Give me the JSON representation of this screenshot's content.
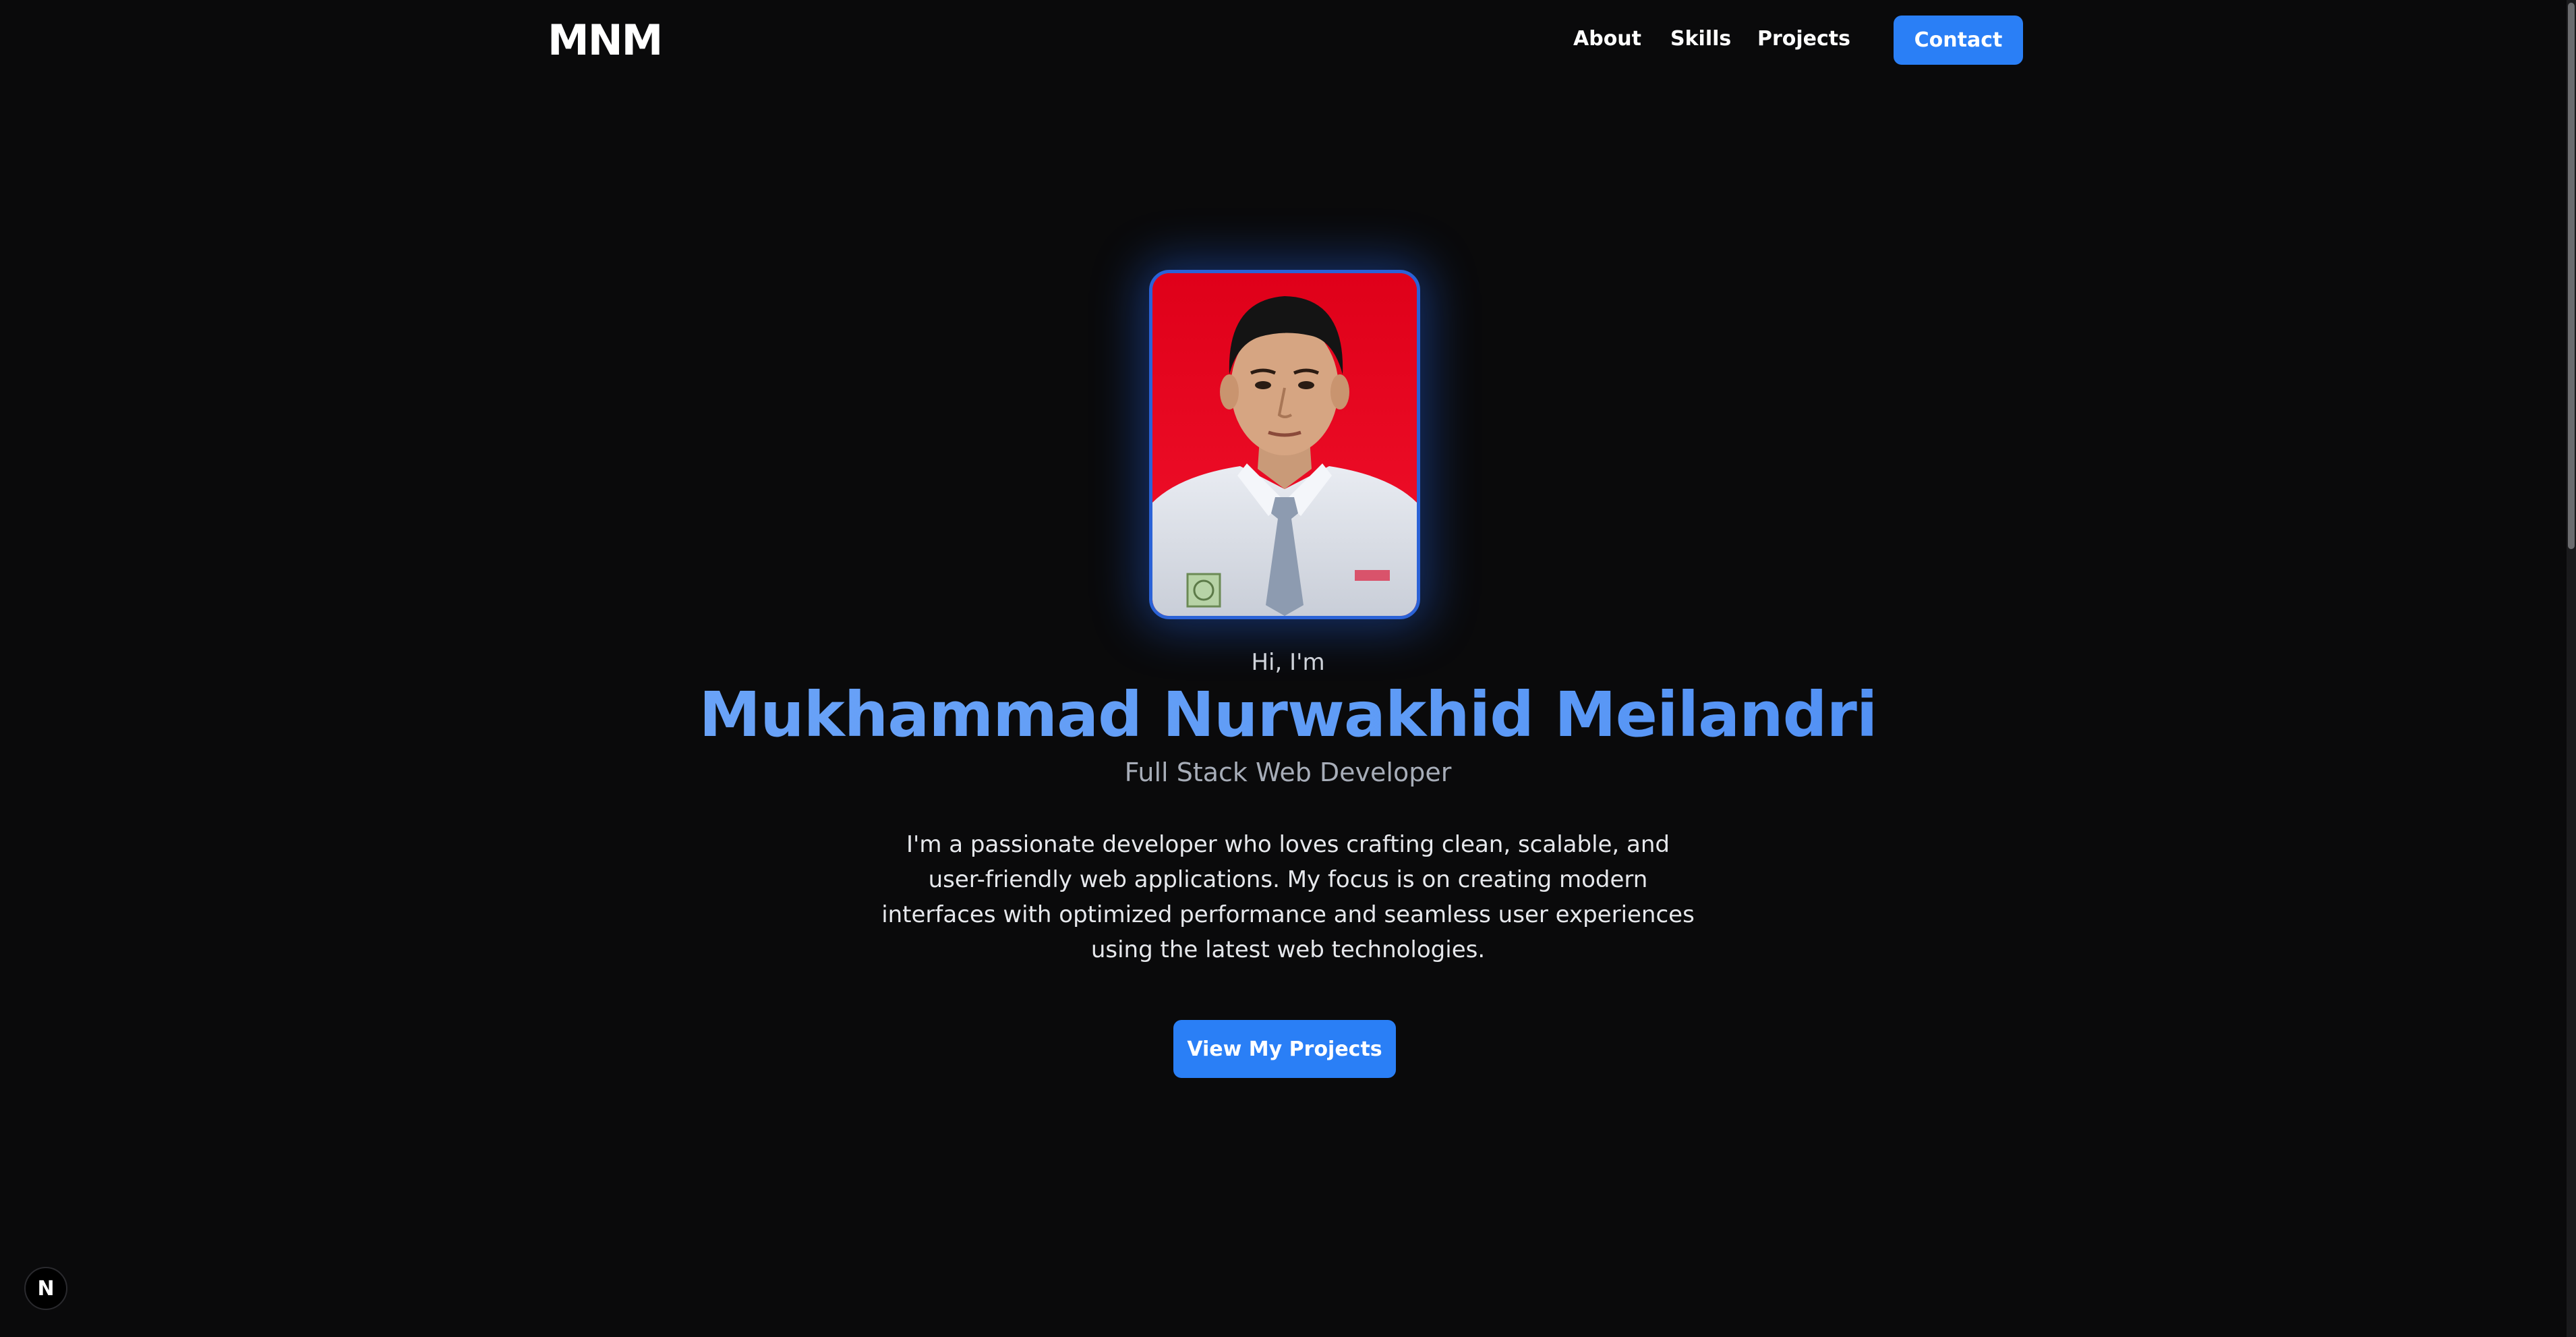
{
  "nav": {
    "brand": "MNM",
    "links": [
      {
        "label": "About"
      },
      {
        "label": "Skills"
      },
      {
        "label": "Projects"
      }
    ],
    "contact_label": "Contact"
  },
  "hero": {
    "greeting": "Hi, I'm",
    "name": "Mukhammad Nurwakhid Meilandri",
    "role": "Full Stack Web Developer",
    "bio": "I'm a passionate developer who loves crafting clean, scalable, and user-friendly web applications. My focus is on creating modern interfaces with optimized performance and seamless user experiences using the latest web technologies.",
    "cta_label": "View My Projects"
  },
  "badge": {
    "label": "N"
  },
  "colors": {
    "background": "#0a0a0b",
    "accent": "#2a7ff6",
    "name_gradient_start": "#74a9f8",
    "name_gradient_end": "#3f82f2",
    "photo_background": "#e3001a"
  }
}
